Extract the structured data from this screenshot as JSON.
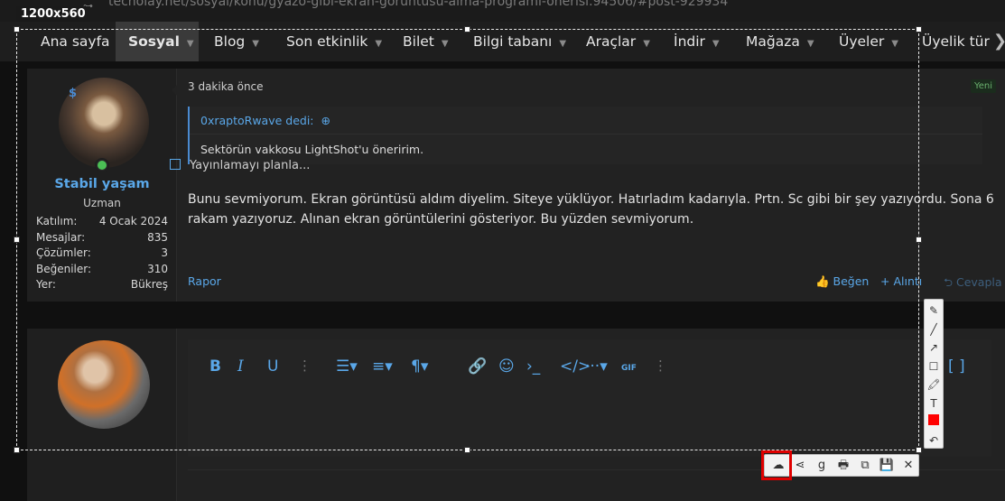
{
  "browser": {
    "url": "techolay.net/sosyal/konu/gyazo-gibi-ekran-goruntusu-alma-programi-onerisi.94506/#post-929934"
  },
  "nav": {
    "items": [
      {
        "label": "Ana sayfa",
        "caret": false,
        "active": false
      },
      {
        "label": "Sosyal",
        "caret": true,
        "active": true
      },
      {
        "label": "Blog",
        "caret": true,
        "active": false
      },
      {
        "label": "Son etkinlik",
        "caret": true,
        "active": false
      },
      {
        "label": "Bilet",
        "caret": true,
        "active": false
      },
      {
        "label": "Bilgi tabanı",
        "caret": true,
        "active": false
      },
      {
        "label": "Araçlar",
        "caret": true,
        "active": false
      },
      {
        "label": "İndir",
        "caret": true,
        "active": false
      },
      {
        "label": "Mağaza",
        "caret": true,
        "active": false
      },
      {
        "label": "Üyeler",
        "caret": true,
        "active": false
      },
      {
        "label": "Üyelik tür",
        "caret": false,
        "active": false
      }
    ],
    "caret_glyph": "▼",
    "more_glyph": "❯"
  },
  "post": {
    "user": {
      "name": "Stabil yaşam",
      "title": "Uzman",
      "badge": "$",
      "stats": [
        {
          "label": "Katılım:",
          "value": "4 Ocak 2024"
        },
        {
          "label": "Mesajlar:",
          "value": "835"
        },
        {
          "label": "Çözümler:",
          "value": "3"
        },
        {
          "label": "Beğeniler:",
          "value": "310"
        },
        {
          "label": "Yer:",
          "value": "Bükreş"
        }
      ]
    },
    "time": "3 dakika önce",
    "new_badge": "Yeni",
    "quote": {
      "author": "0xraptoRwave dedi:",
      "arrow_icon": "⊕",
      "text": "Sektörün vakkosu LightShot'u öneririm."
    },
    "body": "Bunu sevmiyorum. Ekran görüntüsü aldım diyelim. Siteye yüklüyor. Hatırladım kadarıyla. Prtn. Sc gibi bir şey yazıyordu. Sona 6 rakam yazıyoruz. Alınan ekran görüntülerini gösteriyor. Bu yüzden sevmiyorum.",
    "report": "Rapor",
    "like": "👍 Beğen",
    "quote_action": "+ Alıntı",
    "reply_action": "⮌ Cevapla"
  },
  "editor": {
    "toolbar": [
      {
        "name": "bold-button",
        "glyph": "B",
        "cls": "bold"
      },
      {
        "name": "italic-button",
        "glyph": "I",
        "cls": "ital"
      },
      {
        "name": "underline-button",
        "glyph": "U",
        "cls": ""
      },
      {
        "name": "toolbar-more-1",
        "glyph": "⋮",
        "cls": "sep"
      },
      {
        "name": "list-button",
        "glyph": "☰▾",
        "cls": ""
      },
      {
        "name": "align-button",
        "glyph": "≡▾",
        "cls": ""
      },
      {
        "name": "paragraph-button",
        "glyph": "¶▾",
        "cls": ""
      },
      {
        "name": "link-button",
        "glyph": "🔗",
        "cls": ""
      },
      {
        "name": "emoji-button",
        "glyph": "☺",
        "cls": ""
      },
      {
        "name": "code-inline-button",
        "glyph": "›_",
        "cls": ""
      },
      {
        "name": "code-button",
        "glyph": "</>",
        "cls": ""
      },
      {
        "name": "more-options-button",
        "glyph": "···▾",
        "cls": ""
      },
      {
        "name": "gif-button",
        "glyph": "GIF",
        "cls": "sm"
      },
      {
        "name": "toolbar-more-2",
        "glyph": "⋮",
        "cls": "sep"
      },
      {
        "name": "bbcode-button",
        "glyph": "[ ]",
        "cls": ""
      }
    ],
    "schedule_label": "Yayınlamayı planla..."
  },
  "screenshot_tool": {
    "size_label": "1200x560",
    "vertical_tools": [
      "✎",
      "╱",
      "↗",
      "☐",
      "🖍",
      "T",
      "",
      "↶"
    ],
    "horizontal_tools": [
      "☁",
      "⋖",
      "g",
      "🖶",
      "⧉",
      "💾",
      "✕"
    ],
    "accent_color": "#ff0000"
  }
}
